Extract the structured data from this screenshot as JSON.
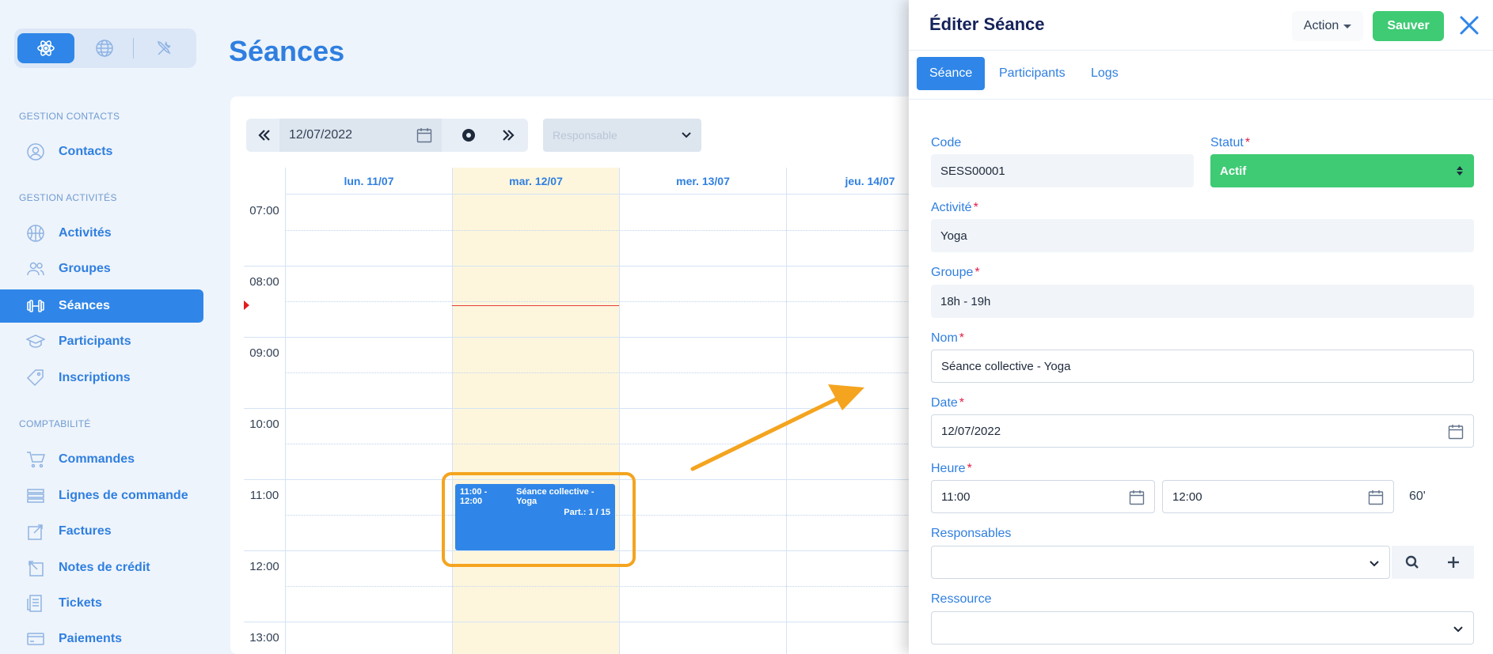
{
  "sidebar": {
    "sections": [
      {
        "title": "GESTION CONTACTS"
      },
      {
        "title": "GESTION ACTIVITÉS"
      },
      {
        "title": "COMPTABILITÉ"
      }
    ],
    "items": [
      {
        "label": "Contacts",
        "icon": "user-circle-icon"
      },
      {
        "label": "Activités",
        "icon": "basketball-icon"
      },
      {
        "label": "Groupes",
        "icon": "users-icon"
      },
      {
        "label": "Séances",
        "icon": "dumbbell-icon",
        "active": true
      },
      {
        "label": "Participants",
        "icon": "graduation-cap-icon"
      },
      {
        "label": "Inscriptions",
        "icon": "tag-icon"
      },
      {
        "label": "Commandes",
        "icon": "cart-icon"
      },
      {
        "label": "Lignes de commande",
        "icon": "list-lines-icon"
      },
      {
        "label": "Factures",
        "icon": "invoice-icon"
      },
      {
        "label": "Notes de crédit",
        "icon": "credit-note-icon"
      },
      {
        "label": "Tickets",
        "icon": "ticket-icon"
      },
      {
        "label": "Paiements",
        "icon": "card-icon"
      }
    ]
  },
  "page": {
    "title": "Séances"
  },
  "calendar": {
    "date": "12/07/2022",
    "responsable_placeholder": "Responsable",
    "days": [
      "lun. 11/07",
      "mar. 12/07",
      "mer. 13/07",
      "jeu. 14/07"
    ],
    "hours": [
      "07:00",
      "08:00",
      "09:00",
      "10:00",
      "11:00",
      "12:00",
      "13:00"
    ],
    "event": {
      "time": "11:00 - 12:00",
      "title": "Séance collective - Yoga",
      "participants": "Part.: 1 / 15"
    }
  },
  "panel": {
    "title": "Éditer Séance",
    "action_label": "Action",
    "save_label": "Sauver",
    "tabs": [
      "Séance",
      "Participants",
      "Logs"
    ],
    "fields": {
      "code_label": "Code",
      "code_value": "SESS00001",
      "statut_label": "Statut",
      "statut_value": "Actif",
      "activite_label": "Activité",
      "activite_value": "Yoga",
      "groupe_label": "Groupe",
      "groupe_value": "18h - 19h",
      "nom_label": "Nom",
      "nom_value": "Séance collective - Yoga",
      "date_label": "Date",
      "date_value": "12/07/2022",
      "heure_label": "Heure",
      "heure_start": "11:00",
      "heure_end": "12:00",
      "duration": "60'",
      "responsables_label": "Responsables",
      "ressource_label": "Ressource"
    },
    "required_mark": "*"
  },
  "colors": {
    "accent": "#2f86e8",
    "save": "#3ecb74",
    "highlight": "#f4a41f",
    "today": "#fdf6dd"
  }
}
